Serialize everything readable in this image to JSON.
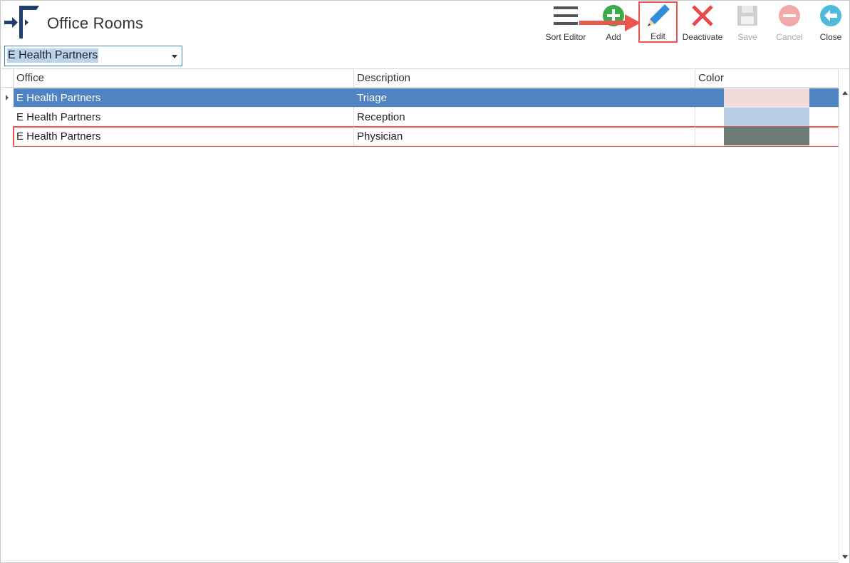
{
  "window": {
    "title": "Office Rooms"
  },
  "toolbar": {
    "sort_editor": {
      "label": "Sort Editor",
      "icon": "hamburger-icon",
      "enabled": true
    },
    "add": {
      "label": "Add",
      "icon": "plus-circle-icon",
      "enabled": true
    },
    "edit": {
      "label": "Edit",
      "icon": "pencil-icon",
      "enabled": true
    },
    "deactivate": {
      "label": "Deactivate",
      "icon": "x-icon",
      "enabled": true
    },
    "save": {
      "label": "Save",
      "icon": "floppy-disk-icon",
      "enabled": false
    },
    "cancel": {
      "label": "Cancel",
      "icon": "minus-circle-icon",
      "enabled": false
    },
    "close": {
      "label": "Close",
      "icon": "arrow-left-circle-icon",
      "enabled": true
    }
  },
  "office_select": {
    "value": "E Health Partners"
  },
  "grid": {
    "columns": [
      "Office",
      "Description",
      "Color"
    ],
    "rows": [
      {
        "office": "E Health Partners",
        "description": "Triage",
        "color": "#f2dcdb",
        "selected": true
      },
      {
        "office": "E Health Partners",
        "description": "Reception",
        "color": "#b8cce4",
        "selected": false
      },
      {
        "office": "E Health Partners",
        "description": "Physician",
        "color": "#6d7b77",
        "selected": false
      }
    ]
  },
  "colors": {
    "selection": "#5083c1",
    "annotation": "#e8564d",
    "logo": "#1f3f6e",
    "add_green": "#3aaa4a",
    "edit_blue": "#2e8fd6",
    "deactivate_red": "#e84a4a",
    "close_teal": "#4fb9d9"
  }
}
